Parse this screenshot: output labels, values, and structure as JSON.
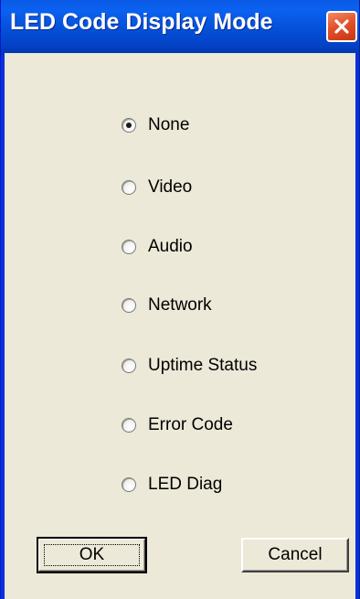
{
  "window": {
    "title": "LED Code Display Mode",
    "close_icon": "close-icon"
  },
  "options": [
    {
      "label": "None",
      "selected": true
    },
    {
      "label": "Video",
      "selected": false
    },
    {
      "label": "Audio",
      "selected": false
    },
    {
      "label": "Network",
      "selected": false
    },
    {
      "label": "Uptime Status",
      "selected": false
    },
    {
      "label": "Error Code",
      "selected": false
    },
    {
      "label": "LED Diag",
      "selected": false
    }
  ],
  "buttons": {
    "ok_label": "OK",
    "cancel_label": "Cancel"
  },
  "colors": {
    "titlebar": "#0550d8",
    "client_bg": "#ece9d8",
    "close_button": "#e3522a"
  }
}
